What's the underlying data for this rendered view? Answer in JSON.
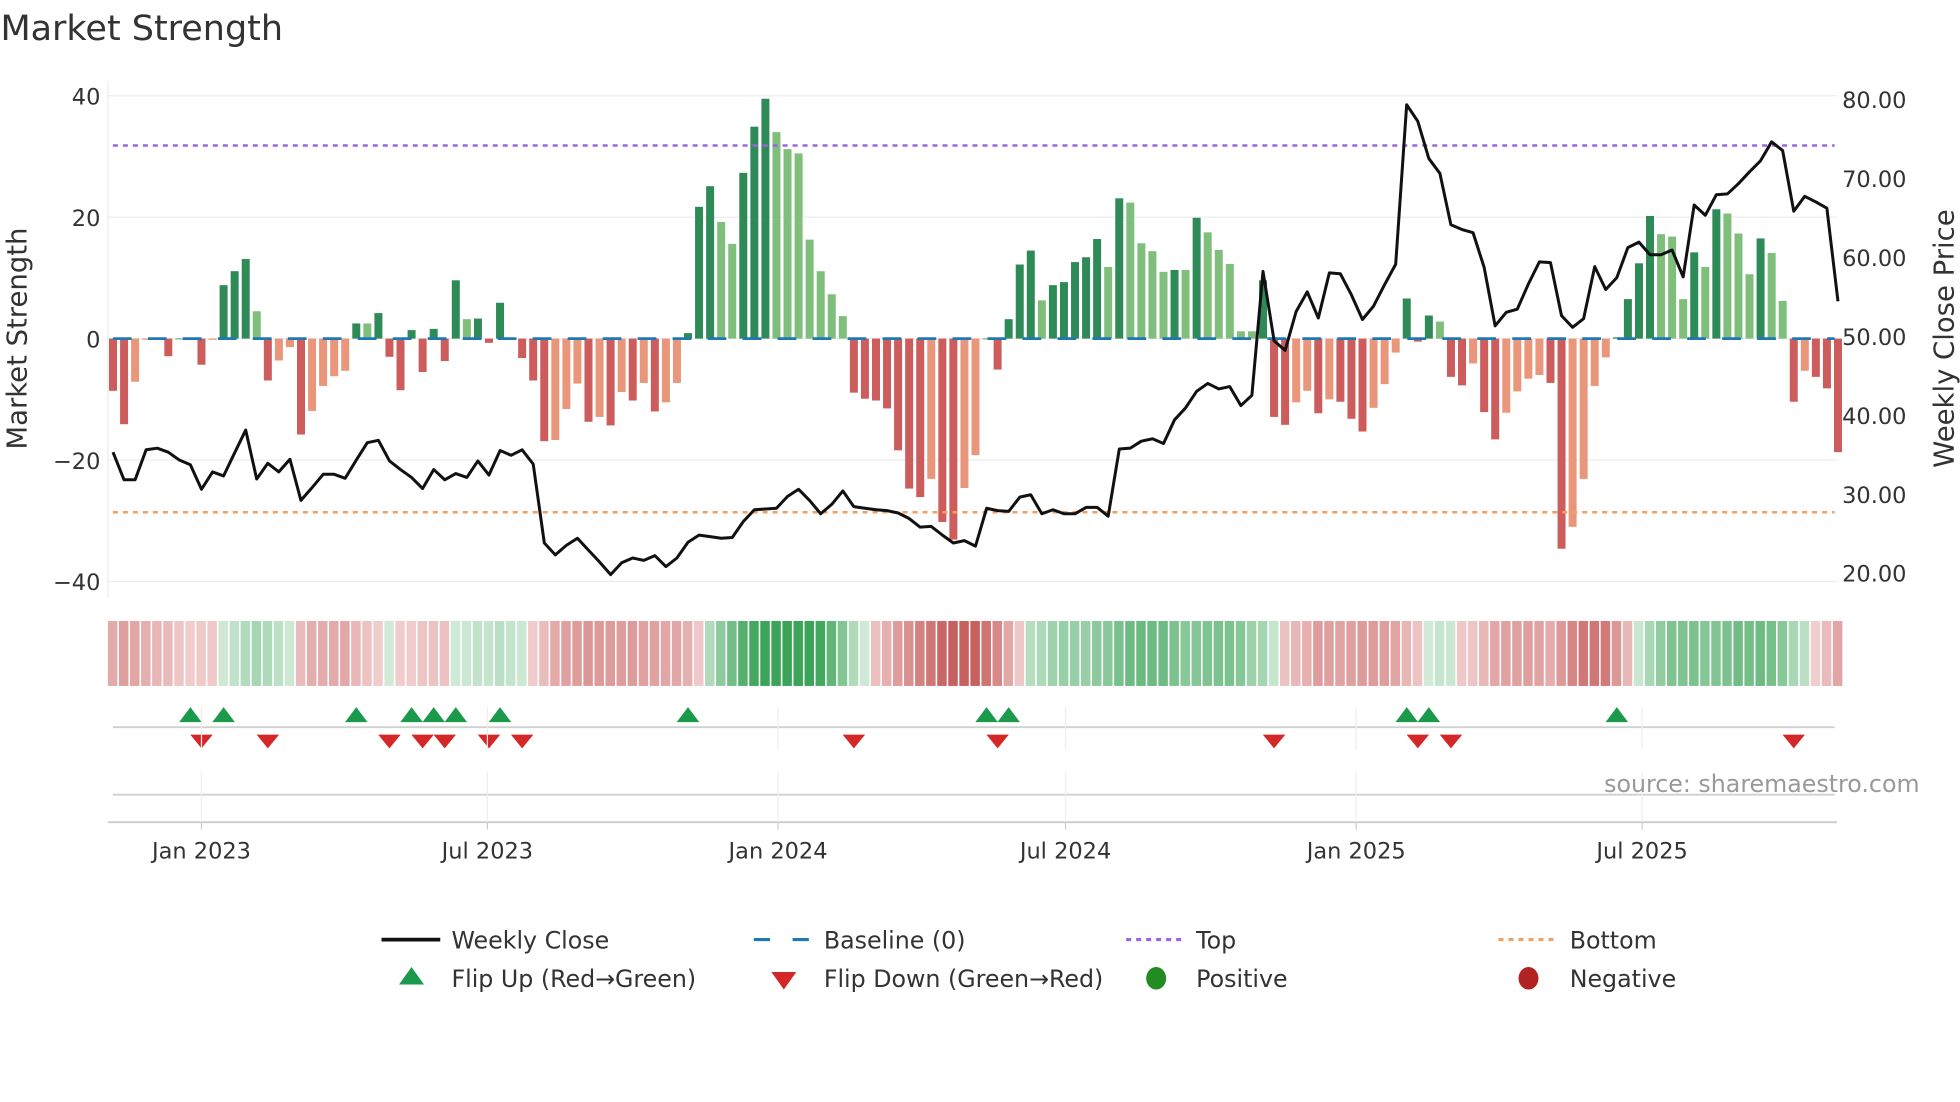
{
  "chart_data": {
    "type": "bar",
    "title": "Market Strength",
    "ylabel": "Market Strength",
    "y2label": "Weekly Close Price",
    "ylim": [
      -40,
      40
    ],
    "y2lim": [
      20,
      80
    ],
    "yticks": [
      "40",
      "20",
      "0",
      "−20",
      "−40"
    ],
    "yticks_values": [
      40,
      20,
      0,
      -20,
      -40
    ],
    "y2ticks": [
      "80.00",
      "70.00",
      "60.00",
      "50.00",
      "40.00",
      "30.00",
      "20.00"
    ],
    "y2ticks_values": [
      80,
      70,
      60,
      50,
      40,
      30,
      20
    ],
    "xticks": [
      {
        "label": "Jan 2023",
        "date": "2023-01-01"
      },
      {
        "label": "Jul 2023",
        "date": "2023-07-01"
      },
      {
        "label": "Jan 2024",
        "date": "2024-01-01"
      },
      {
        "label": "Jul 2024",
        "date": "2024-07-01"
      },
      {
        "label": "Jan 2025",
        "date": "2025-01-01"
      },
      {
        "label": "Jul 2025",
        "date": "2025-07-01"
      }
    ],
    "start_week": "2022-11-06",
    "interval_days": 7,
    "grid": true,
    "top_level": 31.8,
    "bottom_level": -28.6,
    "baseline": 0,
    "strength": [
      -8.6,
      -14.1,
      -7.1,
      -0.2,
      0,
      -2.9,
      0,
      -0.2,
      -4.3,
      -0.2,
      8.8,
      11.1,
      13.1,
      4.5,
      -6.9,
      -3.6,
      -1.4,
      -15.8,
      -11.9,
      -7.8,
      -6.2,
      -5.3,
      2.5,
      2.5,
      4.2,
      -3.0,
      -8.5,
      1.4,
      -5.5,
      1.6,
      -3.7,
      9.6,
      3.2,
      3.3,
      -0.7,
      5.9,
      0.1,
      -3.2,
      -6.9,
      -16.9,
      -16.7,
      -11.6,
      -7.4,
      -13.7,
      -12.9,
      -14.3,
      -8.8,
      -10.2,
      -7.3,
      -12.0,
      -10.5,
      -7.3,
      0.9,
      21.7,
      25.1,
      19.2,
      15.6,
      27.3,
      34.9,
      39.5,
      34.0,
      31.2,
      30.5,
      16.3,
      11.1,
      7.3,
      3.7,
      -8.9,
      -9.9,
      -10.2,
      -11.5,
      -18.4,
      -24.7,
      -26.1,
      -23.1,
      -30.2,
      -33.1,
      -24.6,
      -19.2,
      0,
      -5.1,
      3.2,
      12.2,
      14.5,
      6.3,
      8.8,
      9.3,
      12.6,
      13.4,
      16.4,
      11.8,
      23.1,
      22.4,
      15.7,
      14.4,
      11.0,
      11.3,
      11.3,
      19.9,
      17.5,
      14.6,
      12.3,
      1.2,
      1.2,
      9.6,
      -12.9,
      -14.2,
      -10.5,
      -8.6,
      -12.3,
      -10.0,
      -10.4,
      -13.2,
      -15.3,
      -11.4,
      -7.5,
      -2.3,
      6.6,
      -0.5,
      3.8,
      2.8,
      -6.3,
      -7.7,
      -4.1,
      -12.1,
      -16.6,
      -12.2,
      -8.7,
      -6.6,
      -6.0,
      -7.3,
      -34.6,
      -31.0,
      -23.1,
      -7.8,
      -3.1,
      0.2,
      6.5,
      12.4,
      20.2,
      17.2,
      16.8,
      6.5,
      14.2,
      11.8,
      21.3,
      20.6,
      17.3,
      10.6,
      16.5,
      14.1,
      6.2,
      -10.4,
      -5.3,
      -6.3,
      -8.2,
      -18.7
    ],
    "weekly_close": [
      35.3,
      31.8,
      31.8,
      35.6,
      35.8,
      35.3,
      34.3,
      33.7,
      30.6,
      32.8,
      32.3,
      35.2,
      38.1,
      31.9,
      33.9,
      32.8,
      34.4,
      29.2,
      30.8,
      32.5,
      32.5,
      32.0,
      34.3,
      36.5,
      36.8,
      34.2,
      33.1,
      32.1,
      30.7,
      33.1,
      31.8,
      32.6,
      32.1,
      34.2,
      32.4,
      35.5,
      34.9,
      35.6,
      33.8,
      23.8,
      22.3,
      23.5,
      24.4,
      22.9,
      21.4,
      19.8,
      21.3,
      21.9,
      21.6,
      22.2,
      20.8,
      21.9,
      23.9,
      24.8,
      24.6,
      24.4,
      24.5,
      26.5,
      28.0,
      28.1,
      28.2,
      29.7,
      30.6,
      29.2,
      27.5,
      28.7,
      30.4,
      28.4,
      28.2,
      28.0,
      27.9,
      27.6,
      26.9,
      25.8,
      25.9,
      24.8,
      23.8,
      24.1,
      23.4,
      28.2,
      27.9,
      27.8,
      29.6,
      29.9,
      27.5,
      28.0,
      27.5,
      27.5,
      28.3,
      28.3,
      27.2,
      35.7,
      35.8,
      36.7,
      37.0,
      36.4,
      39.4,
      40.9,
      43.0,
      44.0,
      43.3,
      43.6,
      41.2,
      42.5,
      58.2,
      49.4,
      48.2,
      53.1,
      55.6,
      52.3,
      58.0,
      57.9,
      55.2,
      52.1,
      53.8,
      56.5,
      59.1,
      79.3,
      77.2,
      72.5,
      70.6,
      64.1,
      63.5,
      63.1,
      58.7,
      51.3,
      53.0,
      53.4,
      56.6,
      59.4,
      59.3,
      52.6,
      51.1,
      52.2,
      58.8,
      55.9,
      57.4,
      61.2,
      61.9,
      60.3,
      60.3,
      60.9,
      57.5,
      66.6,
      65.3,
      67.9,
      68.0,
      69.3,
      70.8,
      72.2,
      74.6,
      73.5,
      65.8,
      67.7,
      67.0,
      66.2,
      54.4
    ],
    "flip_up_weeks": [
      7,
      10,
      22,
      27,
      29,
      31,
      35,
      52,
      79,
      81,
      117,
      119,
      136
    ],
    "flip_down_weeks": [
      8,
      14,
      25,
      28,
      30,
      34,
      37,
      67,
      80,
      105,
      118,
      121,
      152
    ],
    "legend": {
      "placement": "bottom",
      "items": [
        {
          "key": "close",
          "label": "Weekly Close"
        },
        {
          "key": "baseline",
          "label": "Baseline (0)"
        },
        {
          "key": "top",
          "label": "Top"
        },
        {
          "key": "bottom",
          "label": "Bottom"
        },
        {
          "key": "flipup",
          "label": "Flip Up (Red→Green)"
        },
        {
          "key": "flipdown",
          "label": "Flip Down (Green→Red)"
        },
        {
          "key": "positive",
          "label": "Positive"
        },
        {
          "key": "negative",
          "label": "Negative"
        }
      ]
    },
    "source": "source: sharemaestro.com",
    "colors": {
      "pos_strong": "#2e8b57",
      "pos_weak": "#7fbf7b",
      "neg_strong": "#cd5c5c",
      "neg_weak": "#e9967a",
      "close": "#111111",
      "baseline": "#1f77b4",
      "top": "#9a66e0",
      "bottom": "#f0a060",
      "flip_up": "#1a9a4a",
      "flip_down": "#d62728",
      "positive": "#228b22",
      "negative": "#b22222"
    }
  }
}
